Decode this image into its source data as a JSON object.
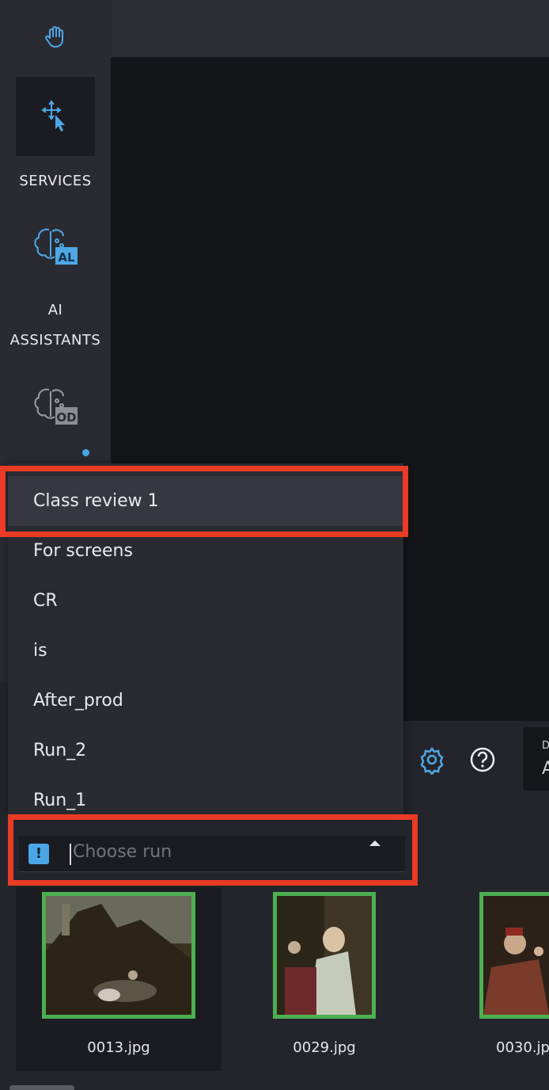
{
  "sidebar": {
    "tools": [
      {
        "icon": "hand-icon"
      },
      {
        "icon": "move-select-icon"
      }
    ],
    "services_label": "SERVICES",
    "ai_assistants": {
      "icon": "brain-al-icon",
      "badge": "AL",
      "label_line1": "AI",
      "label_line2": "ASSISTANTS"
    },
    "od": {
      "icon": "brain-od-icon",
      "badge": "OD"
    }
  },
  "toolbar": {
    "settings_icon": "gear-icon",
    "help_icon": "help-icon",
    "dropdown_label": "D",
    "dropdown_value": "A"
  },
  "run_menu": {
    "items": [
      "Class review 1",
      "For screens",
      "CR",
      "is",
      "After_prod",
      "Run_2",
      "Run_1"
    ],
    "selected_index": 0
  },
  "run_input": {
    "placeholder": "Choose run",
    "warning_icon": "exclamation-icon",
    "warning_symbol": "!"
  },
  "thumbnails": [
    {
      "name": "0013.jpg"
    },
    {
      "name": "0029.jpg"
    },
    {
      "name": "0030.jpg"
    }
  ],
  "colors": {
    "accent": "#46a8e8",
    "highlight": "#ea3b25",
    "thumb_border": "#4caf50"
  }
}
